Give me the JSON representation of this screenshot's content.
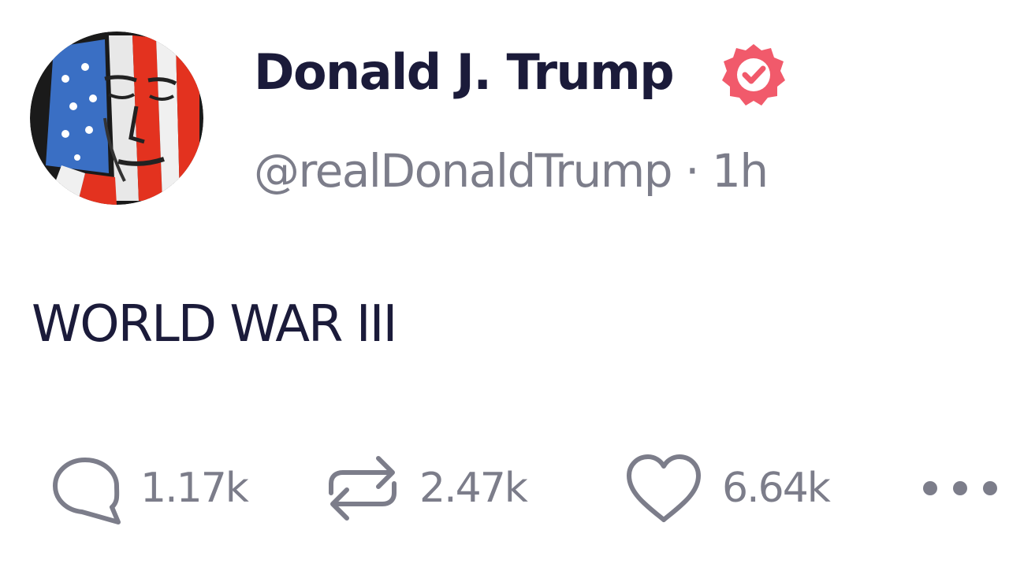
{
  "post": {
    "author": {
      "display_name": "Donald J. Trump",
      "handle": "@realDonaldTrump",
      "verified_icon": "verified-badge-icon",
      "badge_color": "#f15a6b"
    },
    "timestamp": "1h",
    "separator": "·",
    "text": "WORLD WAR III",
    "actions": {
      "replies": "1.17k",
      "reposts": "2.47k",
      "likes": "6.64k"
    },
    "icons": {
      "reply": "speech-bubble-icon",
      "repost": "repost-arrows-icon",
      "like": "heart-icon",
      "more": "ellipsis-icon"
    },
    "colors": {
      "text_primary": "#1b1b3a",
      "text_secondary": "#7c7d8a"
    }
  }
}
